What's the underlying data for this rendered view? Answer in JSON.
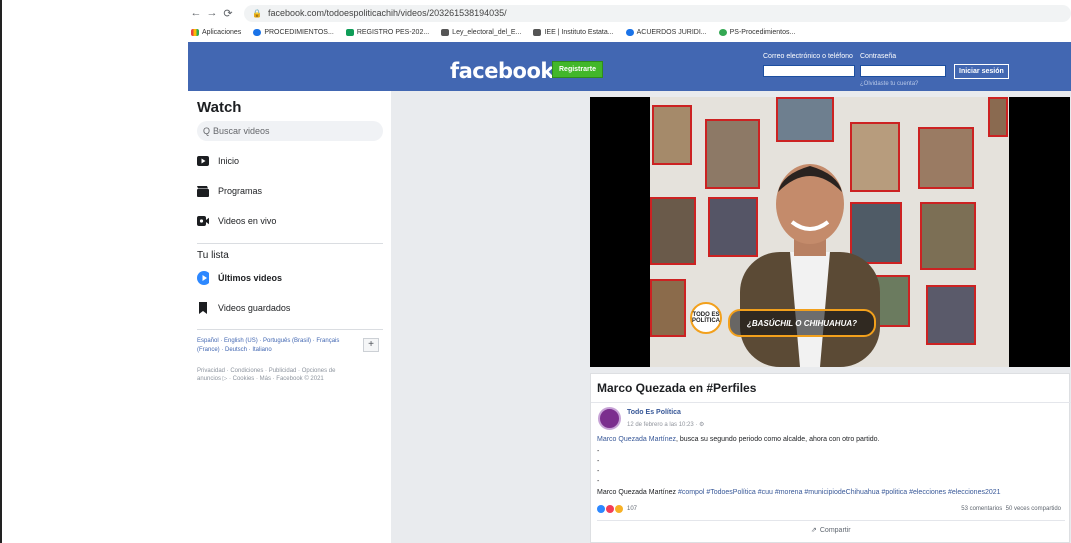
{
  "browser": {
    "url": "facebook.com/todoespoliticachih/videos/203261538194035/",
    "bookmarks": [
      {
        "label": "Aplicaciones",
        "icon": "apps-grid-icon",
        "color": "#e8453c"
      },
      {
        "label": "PROCEDIMIENTOS...",
        "icon": "cloud-icon",
        "color": "#1a73e8"
      },
      {
        "label": "REGISTRO PES-202...",
        "icon": "sheets-icon",
        "color": "#0f9d58"
      },
      {
        "label": "Ley_electoral_del_E...",
        "icon": "building-icon",
        "color": "#555555"
      },
      {
        "label": "IEE | Instituto Estata...",
        "icon": "building-icon",
        "color": "#555555"
      },
      {
        "label": "ACUERDOS JURIDI...",
        "icon": "cloud-icon",
        "color": "#1a73e8"
      },
      {
        "label": "PS-Procedimientos...",
        "icon": "drive-icon",
        "color": "#34a853"
      }
    ]
  },
  "header": {
    "logo": "facebook",
    "register_label": "Registrarte",
    "email_label": "Correo electrónico o teléfono",
    "password_label": "Contraseña",
    "login_label": "Iniciar sesión",
    "forgot_label": "¿Olvidaste tu cuenta?"
  },
  "sidebar": {
    "title": "Watch",
    "search_placeholder": "Buscar videos",
    "nav": [
      {
        "label": "Inicio",
        "icon": "play-icon"
      },
      {
        "label": "Programas",
        "icon": "clapper-icon"
      },
      {
        "label": "Videos en vivo",
        "icon": "live-video-icon"
      }
    ],
    "list_title": "Tu lista",
    "list": [
      {
        "label": "Últimos videos",
        "icon": "play-circle-icon"
      },
      {
        "label": "Videos guardados",
        "icon": "bookmark-icon"
      }
    ],
    "languages": "Español · English (US) · Português (Brasil) · Français (France) · Deutsch · Italiano",
    "legal": "Privacidad · Condiciones · Publicidad · Opciones de anuncios ▷ · Cookies · Más · Facebook © 2021"
  },
  "video": {
    "caption": "¿BASÚCHIL O CHIHUAHUA?",
    "badge": "TODO ES POLÍTICA"
  },
  "post": {
    "video_title": "Marco Quezada en #Perfiles",
    "page_name": "Todo Es Política",
    "date": "12 de febrero a las 10:23 · ",
    "mention": "Marco Quezada Martínez",
    "text": ", busca su segundo periodo como alcalde, ahora con otro partido.",
    "dashes": [
      "-",
      "-",
      "-",
      "-"
    ],
    "hashtag_prefix": "Marco Quezada Martínez ",
    "hashtags": "#compol #TodoesPolítica #cuu #morena #municipiodeChihuahua #politica #elecciones #elecciones2021",
    "reaction_count": "107",
    "comments": "53 comentarios",
    "shares": "50 veces compartido",
    "share_label": "Compartir"
  },
  "colors": {
    "facebook_blue": "#4267b2",
    "green": "#42b72a",
    "link": "#385898"
  }
}
